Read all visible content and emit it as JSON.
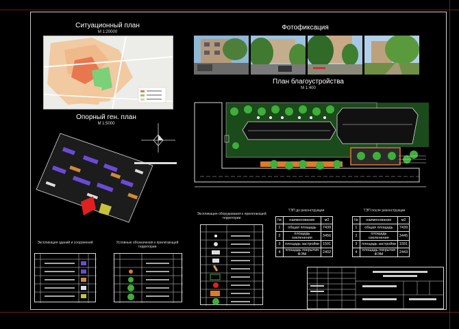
{
  "situational_plan": {
    "title": "Ситуационный план",
    "scale": "М 1:20000"
  },
  "photo_fixation": {
    "title": "Фотофиксация"
  },
  "improvement_plan": {
    "title": "План благоустройства",
    "scale": "М 1:400"
  },
  "reference_general_plan": {
    "title": "Опорный ген. план",
    "scale": "М 1:5000"
  },
  "equipment_explication": {
    "title": "Экспликация оборудования к прилегающей территории"
  },
  "buildings_explication": {
    "title": "Экспликация зданий и сооружений"
  },
  "legend": {
    "title": "Условные обозначения к прилегающей территории"
  },
  "tep_before": {
    "title": "ТЭП до реконструкции",
    "headers": [
      "№",
      "наименование",
      "м2"
    ],
    "rows": [
      [
        "1",
        "общая площадь",
        "7439"
      ],
      [
        "2",
        "площадь озеленения",
        "3456"
      ],
      [
        "3",
        "площадь застройки",
        "1591"
      ],
      [
        "4",
        "площадь покрытия ФЭМ",
        "2402"
      ]
    ]
  },
  "tep_after": {
    "title": "ТЭП после реконструкции",
    "headers": [
      "№",
      "наименование",
      "м2"
    ],
    "rows": [
      [
        "1",
        "общая площадь",
        "7439"
      ],
      [
        "2",
        "площадь озеленения",
        "3445"
      ],
      [
        "3",
        "площадь застройки",
        "1591"
      ],
      [
        "4",
        "площадь покрытия ФЭМ",
        "2443"
      ]
    ]
  },
  "colors": {
    "frame": "#cfcfcf",
    "map_bg": "#ededea",
    "highlight": "#e05a3a",
    "green": "#3a8f2f",
    "road": "#d9d9d9"
  }
}
